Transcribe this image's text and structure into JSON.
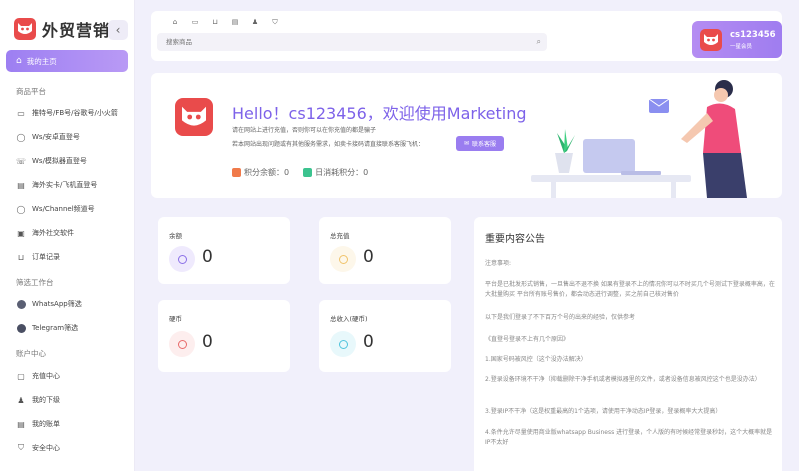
{
  "brand": {
    "name": "外贸营销",
    "collapse_icon": "chevron-left-icon"
  },
  "sidebar": {
    "home": "我的主页",
    "section1": "商品平台",
    "items1": [
      {
        "label": "推特号/FB号/谷歌号/小火箭",
        "icon": "message-icon"
      },
      {
        "label": "Ws/安卓直登号",
        "icon": "whatsapp-icon"
      },
      {
        "label": "Ws/模拟器直登号",
        "icon": "phone-icon"
      },
      {
        "label": "海外实卡/飞机直登号",
        "icon": "document-icon"
      },
      {
        "label": "Ws/Channel频道号",
        "icon": "whatsapp-icon"
      },
      {
        "label": "海外社交软件",
        "icon": "box-icon"
      },
      {
        "label": "订单记录",
        "icon": "cart-icon"
      }
    ],
    "section2": "筛选工作台",
    "items2": [
      {
        "label": "WhatsApp筛选",
        "icon": "whatsapp-filled-icon",
        "color": "#5a5f73"
      },
      {
        "label": "Telegram筛选",
        "icon": "telegram-icon",
        "color": "#4a4f63"
      }
    ],
    "section3": "账户中心",
    "items3": [
      {
        "label": "充值中心",
        "icon": "recharge-icon"
      },
      {
        "label": "我的下级",
        "icon": "users-icon"
      },
      {
        "label": "我的账单",
        "icon": "bill-icon"
      },
      {
        "label": "安全中心",
        "icon": "shield-icon"
      }
    ]
  },
  "topbar": {
    "icons": [
      "home-icon",
      "card-icon",
      "cart-icon",
      "document-icon",
      "user-icon",
      "shield-icon"
    ],
    "search_placeholder": "搜索商品"
  },
  "user": {
    "name": "cs123456",
    "role": "一星会员"
  },
  "welcome": {
    "title": "Hello！cs123456，欢迎使用Marketing",
    "line1": "请在网站上进行充值，否则你可以在你充值的都是骗子",
    "line2": "若本网站出现问题或有其他服务需求，如卖卡接码请直接联系客服飞机：",
    "contact_button": "联系客服",
    "points_label": "积分余额：",
    "points_value": "0",
    "daily_label": "日消耗积分：",
    "daily_value": "0"
  },
  "stats": [
    {
      "label": "余额",
      "value": "0",
      "color": "#8b6fe8",
      "bg": "#efeafd"
    },
    {
      "label": "总充值",
      "value": "0",
      "color": "#f0c36a",
      "bg": "#fdf7ea"
    },
    {
      "label": "硬币",
      "value": "0",
      "color": "#e86a6a",
      "bg": "#fdeeee"
    },
    {
      "label": "总收入(硬币)",
      "value": "0",
      "color": "#4fc3dc",
      "bg": "#e8f8fb"
    }
  ],
  "announcement": {
    "title": "重要内容公告",
    "lines": [
      "注意事项:",
      "平台是已批发形式销售，一旦售出不退不换 如果有登录不上的情况你可以不时买几个号测试下登录概率高，在大批量购买 平台所有账号售价，都会动态进行调整，买之前自己核对售价",
      "以下是我们登录了不下百万个号的出来的经验，仅供参考",
      "《直登号登录不上有几个原因》",
      "1.国家号码被风控（这个没办法解决）",
      "2.登录设备环境不干净（抑载删除干净手机或者模拟器里的文件，或者设备信息被风控这个也是没办法）",
      "3.登录IP不干净（这是权重最高的1个选项，请使用干净动态IP登录，登录概率大大提高）",
      "4.条件允许尽量使用商业版whatsapp Business 进行登录，个人版的有时候经常登录秒封，这个大概率就是IP不太好"
    ]
  },
  "colors": {
    "accent": "#9a7df0",
    "brand_red": "#e94b4b",
    "background": "#f1f0fb"
  }
}
